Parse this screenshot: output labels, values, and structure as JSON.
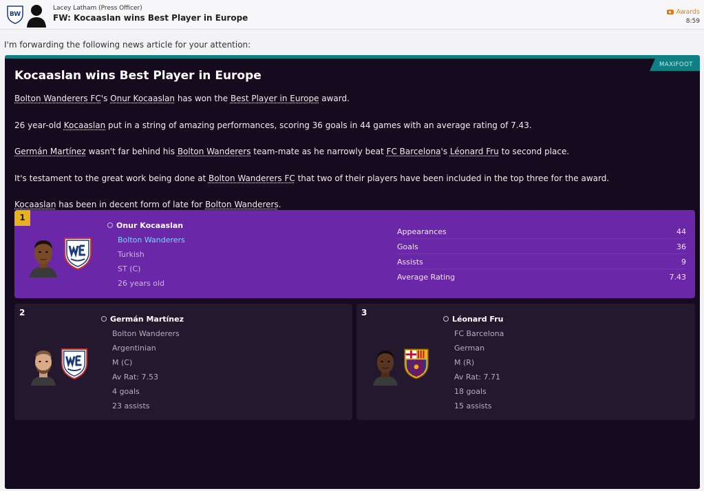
{
  "header": {
    "sender": "Lacey Latham",
    "sender_role": "(Press Officer)",
    "subject": "FW: Kocaaslan wins Best Player in Europe",
    "tag": "Awards",
    "time": "8:59",
    "club_badge_initials": "BW"
  },
  "intro": "I'm forwarding the following news article for your attention:",
  "article": {
    "source": "MAXIFOOT",
    "title": "Kocaaslan wins Best Player in Europe",
    "p1": {
      "club": "Bolton Wanderers FC",
      "t1": "'s ",
      "player": "Onur Kocaaslan",
      "t2": " has won the ",
      "award": "Best Player in Europe",
      "t3": " award."
    },
    "p2": {
      "t1": "26 year-old ",
      "player": "Kocaaslan",
      "t2": " put in a string of amazing performances, scoring 36 goals in 44 games with an average rating of 7.43."
    },
    "p3": {
      "player": "Germán Martínez",
      "t1": " wasn't far behind his ",
      "club": "Bolton Wanderers",
      "t2": " team-mate as he narrowly beat ",
      "club2": "FC Barcelona",
      "t3": "'s ",
      "player2": "Léonard Fru",
      "t4": " to second place."
    },
    "p4": {
      "t1": "It's testament to the great work being done at ",
      "club": "Bolton Wanderers FC",
      "t2": " that two of their players have been included in the top three for the award."
    },
    "p5": {
      "player": "Kocaaslan",
      "t1": " has been in decent form of late for ",
      "club": "Bolton Wanderers",
      "t2": "."
    }
  },
  "winner": {
    "rank": "1",
    "name": "Onur Kocaaslan",
    "club": "Bolton Wanderers",
    "nationality": "Turkish",
    "position": "ST (C)",
    "age": "26 years old",
    "stats": [
      {
        "label": "Appearances",
        "value": "44"
      },
      {
        "label": "Goals",
        "value": "36"
      },
      {
        "label": "Assists",
        "value": "9"
      },
      {
        "label": "Average Rating",
        "value": "7.43"
      }
    ]
  },
  "second": {
    "rank": "2",
    "name": "Germán Martínez",
    "club": "Bolton Wanderers",
    "nationality": "Argentinian",
    "position": "M (C)",
    "rating": "Av Rat: 7.53",
    "goals": "4 goals",
    "assists": "23 assists"
  },
  "third": {
    "rank": "3",
    "name": "Léonard Fru",
    "club": "FC Barcelona",
    "nationality": "German",
    "position": "M (R)",
    "rating": "Av Rat: 7.71",
    "goals": "18 goals",
    "assists": "15 assists"
  },
  "colors": {
    "panel_bg": "#160a1f",
    "accent_teal": "#0f7f83",
    "winner_bg": "#6a27a8",
    "rank_gold": "#e8b120",
    "runner_bg": "#24182e",
    "tag_orange": "#e07a17",
    "link_blue": "#7fd3ff"
  }
}
